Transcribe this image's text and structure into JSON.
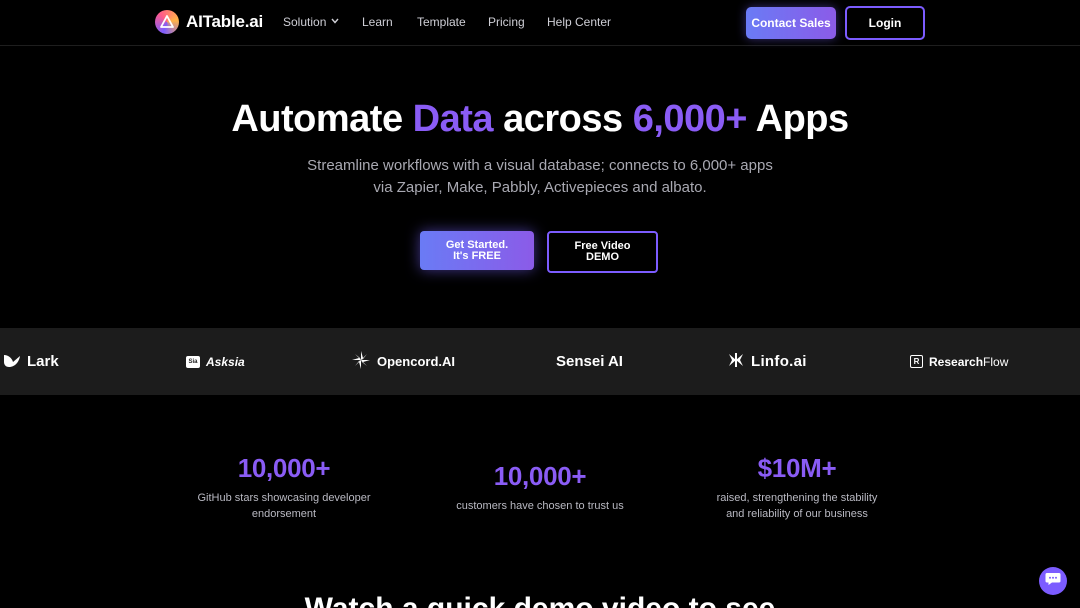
{
  "nav": {
    "brand": "AITable.ai",
    "links": [
      "Solution",
      "Learn",
      "Template",
      "Pricing",
      "Help Center"
    ],
    "contact_label": "Contact Sales",
    "login_label": "Login"
  },
  "hero": {
    "title_part1": "Automate ",
    "title_accent1": "Data",
    "title_part2": " across ",
    "title_accent2": "6,000+",
    "title_part3": " Apps",
    "subtitle_line1": "Streamline workflows with a visual database; connects to 6,000+ apps",
    "subtitle_line2": "via Zapier, Make, Pabbly, Activepieces and albato.",
    "start_line1": "Get Started.",
    "start_line2": "It's FREE",
    "demo_line1": "Free Video",
    "demo_line2": "DEMO"
  },
  "partners": {
    "lark": "Lark",
    "asksia": "Asksia",
    "opencord": "Opencord.AI",
    "sensei": "Sensei AI",
    "linfo": "Linfo.ai",
    "research_bold": "Research",
    "research_light": "Flow"
  },
  "stats": [
    {
      "number": "10,000+",
      "line1": "GitHub stars showcasing developer",
      "line2": "endorsement"
    },
    {
      "number": "10,000+",
      "line1": "customers have chosen to trust us",
      "line2": ""
    },
    {
      "number": "$10M+",
      "line1": "raised, strengthening the stability",
      "line2": "and reliability of our business"
    }
  ],
  "bottom_heading": "Watch a quick demo video to see",
  "colors": {
    "accent": "#8a5cf5",
    "button_gradient_start": "#6a7bf5",
    "button_gradient_end": "#8b5be8",
    "strip_bg": "#1c1c1c"
  },
  "icons": [
    "chevron-down-icon",
    "chat-icon",
    "lark-logo-icon",
    "opencord-logo-icon",
    "linfo-logo-icon",
    "researchflow-logo-icon"
  ]
}
